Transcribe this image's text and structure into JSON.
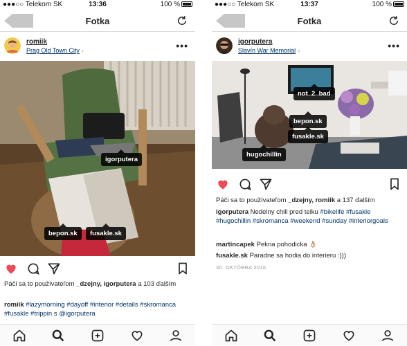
{
  "left": {
    "status": {
      "carrier": "●●●○○ Telekom SK",
      "time": "13:36",
      "battery": "100 %"
    },
    "nav": {
      "title": "Fotka"
    },
    "post": {
      "username": "romiik",
      "location": "Prag Old Town City",
      "tags": [
        "igorputera",
        "bepon.sk",
        "fusakle.sk"
      ],
      "likes_prefix": "Páči sa to používateľom",
      "likes_users": "_dzejny, igorputera",
      "likes_suffix": "a 103 ďalším",
      "caption_user": "romiik",
      "caption": [
        "#lazymorning",
        "#dayoff",
        "#interior",
        "#details",
        "#skromanca",
        "#fusakle",
        "#trippin",
        "s",
        "@igorputera"
      ]
    }
  },
  "right": {
    "status": {
      "carrier": "●●●○○ Telekom SK",
      "time": "13:37",
      "battery": "100 %"
    },
    "nav": {
      "title": "Fotka"
    },
    "post": {
      "username": "igorputera",
      "location": "Slavín War Memorial",
      "tags": [
        "not_2_bad",
        "bepon.sk",
        "fusakle.sk",
        "hugochillin"
      ],
      "likes_prefix": "Páči sa to používateľom",
      "likes_users": "_dzejny, romiik",
      "likes_suffix": "a 137 ďalším",
      "caption_user": "igorputera",
      "caption_text": "Nedelny chill pred telku",
      "caption_tags": [
        "#bikelife",
        "#fusakle",
        "#hugochillin",
        "#skromanca",
        "#weekend",
        "#sunday",
        "#interiorgoals"
      ],
      "comments": [
        {
          "user": "martincapek",
          "text": "Pekna pohodicka 👌🏼"
        },
        {
          "user": "fusakle.sk",
          "text": "Paradne sa hodia do interieru :)))"
        }
      ],
      "date": "30. OKTÓBRA 2016"
    }
  },
  "colors": {
    "like": "#ed4956",
    "link": "#003569",
    "border": "#dbdbdb"
  },
  "icons": [
    "back-icon",
    "refresh-icon",
    "more-icon",
    "heart-icon",
    "comment-icon",
    "share-icon",
    "bookmark-icon",
    "home-icon",
    "search-icon",
    "add-icon",
    "activity-icon",
    "profile-icon"
  ]
}
